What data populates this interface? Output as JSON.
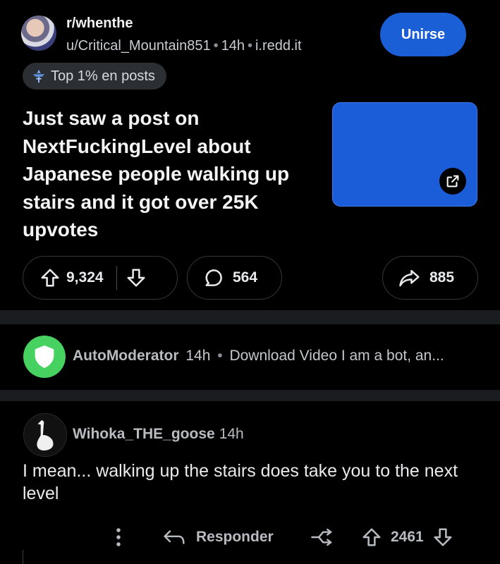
{
  "post": {
    "subreddit": "r/whenthe",
    "author": "u/Critical_Mountain851",
    "age": "14h",
    "domain": "i.redd.it",
    "join_label": "Unirse",
    "badge_label": "Top 1% en posts",
    "title": "Just saw a post on NextFuckingLevel about Japanese people walking up stairs and it got over 25K upvotes",
    "votes": "9,324",
    "comments": "564",
    "shares": "885"
  },
  "automod": {
    "user": "AutoModerator",
    "age": "14h",
    "preview": "Download Video I am a bot, an..."
  },
  "comment": {
    "user": "Wihoka_THE_goose",
    "age": "14h",
    "body": "I mean... walking up the stairs does take you to the next level",
    "reply_label": "Responder",
    "votes": "2461"
  },
  "colors": {
    "accent": "#1a5fd6",
    "automod_green": "#46d160",
    "background": "#000000",
    "separator": "#1a1c1f"
  },
  "icons": [
    "upvote-icon",
    "downvote-icon",
    "comment-icon",
    "share-icon",
    "external-link-icon",
    "shield-icon",
    "reply-icon",
    "award-icon",
    "more-icon",
    "top-badge-icon"
  ]
}
